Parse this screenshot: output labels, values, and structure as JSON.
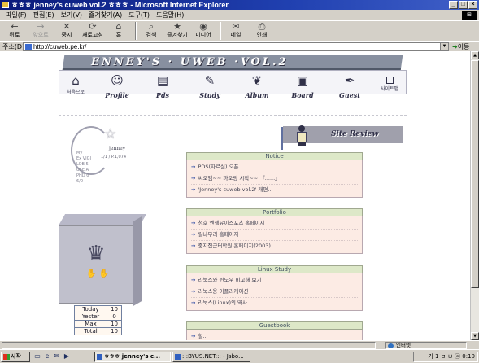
{
  "window": {
    "title": "ㅎㅎㅎ jenney's cuweb vol.2 ㅎㅎㅎ - Microsoft Internet Explorer",
    "controls": [
      "_",
      "□",
      "×"
    ]
  },
  "menu": [
    "파일(F)",
    "편집(E)",
    "보기(V)",
    "즐겨찾기(A)",
    "도구(T)",
    "도움말(H)"
  ],
  "toolbar": [
    {
      "label": "뒤로",
      "icon": "back-icon",
      "glyph": "←",
      "enabled": true
    },
    {
      "label": "앞으로",
      "icon": "forward-icon",
      "glyph": "→",
      "enabled": false
    },
    {
      "label": "중지",
      "icon": "stop-icon",
      "glyph": "✕",
      "enabled": true
    },
    {
      "label": "새로고침",
      "icon": "refresh-icon",
      "glyph": "⟳",
      "enabled": true
    },
    {
      "label": "홈",
      "icon": "home-icon",
      "glyph": "⌂",
      "enabled": true
    },
    {
      "label": "검색",
      "icon": "search-icon",
      "glyph": "⌕",
      "enabled": true
    },
    {
      "label": "즐겨찾기",
      "icon": "favorites-icon",
      "glyph": "★",
      "enabled": true
    },
    {
      "label": "미디어",
      "icon": "media-icon",
      "glyph": "◉",
      "enabled": true
    },
    {
      "label": "메일",
      "icon": "mail-icon",
      "glyph": "✉",
      "enabled": true
    },
    {
      "label": "인쇄",
      "icon": "print-icon",
      "glyph": "⎙",
      "enabled": true
    }
  ],
  "address": {
    "label": "주소(D)",
    "url": "http://cuweb.pe.kr/",
    "go_label": "이동"
  },
  "site": {
    "banner": "ENNEY'S · UWEB ·VOL.2",
    "home_label": "처음으로",
    "sitemap_label": "사이트맵",
    "nav": [
      {
        "label": "Profile",
        "icon": "profile-face-icon",
        "glyph": "☺"
      },
      {
        "label": "Pds",
        "icon": "books-icon",
        "glyph": "▤"
      },
      {
        "label": "Study",
        "icon": "pen-icon",
        "glyph": "✎"
      },
      {
        "label": "Album",
        "icon": "album-icon",
        "glyph": "❦"
      },
      {
        "label": "Board",
        "icon": "board-icon",
        "glyph": "▣"
      },
      {
        "label": "Guest",
        "icon": "quill-icon",
        "glyph": "✒"
      }
    ],
    "profile": {
      "name": "jenney",
      "stat": "1/1 / P.1,074",
      "mini_lines": [
        "My",
        "Ex VIGI",
        "LOB  5",
        "USE  A",
        "PHD  0",
        "6/0"
      ]
    },
    "review_label": "Site Review",
    "counter": [
      {
        "label": "Today",
        "value": "10"
      },
      {
        "label": "Yester",
        "value": "0"
      },
      {
        "label": "Max",
        "value": "10"
      },
      {
        "label": "Total",
        "value": "10"
      }
    ],
    "boards": [
      {
        "title": "Notice",
        "items": [
          "PDS(자료실) 오픈",
          "씨오엠~~ 까오링 시작~~ 『......』",
          "'Jenney's cuweb vol.2' 개편..."
        ]
      },
      {
        "title": "Portfolio",
        "items": [
          "청호 엔젤유이스포츠 홈페이지",
          "릴나무리 홈페이지",
          "중지접근터학원 홈페이지(2003)"
        ]
      },
      {
        "title": "Linux Study",
        "items": [
          "리눅스와 윈도우 비교해 보기",
          "리눅스용 어플리케이션",
          "리눅스(Linux)의 역사"
        ]
      },
      {
        "title": "Guestbook",
        "items": [
          "힐... "
        ]
      }
    ]
  },
  "status": {
    "text": "",
    "zone": "인터넷"
  },
  "taskbar": {
    "start": "시작",
    "quick_launch": [
      "desktop-icon",
      "ie-icon",
      "outlook-icon",
      "media-icon"
    ],
    "tasks": [
      {
        "label": "ㅎㅎㅎ jenney's c...",
        "active": true
      },
      {
        "label": ":::BYUS.NET::: - Jsbo...",
        "active": false
      }
    ],
    "tray": "가 1 ㅁ ㅂ ⓐ 0:10"
  },
  "colors": {
    "title_bar": "#0a1a7a",
    "chrome": "#d4d0c8",
    "board_header": "#dde8c8",
    "board_body": "#fcebe4",
    "page_line": "#c89090"
  }
}
